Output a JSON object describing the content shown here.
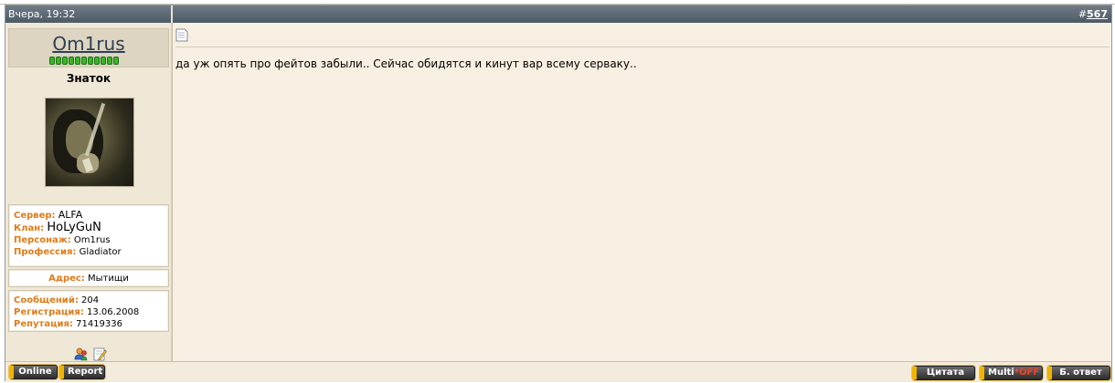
{
  "header": {
    "date": "Вчера, 19:32",
    "post_prefix": "#",
    "post_number": "567"
  },
  "user": {
    "name": "Om1rus",
    "title": "Знаток",
    "reputation_level": 11,
    "info": {
      "server_label": "Сервер:",
      "server_value": "ALFA",
      "clan_label": "Клан:",
      "clan_value": "HoLyGuN",
      "character_label": "Персонаж:",
      "character_value": "Om1rus",
      "profession_label": "Профессия:",
      "profession_value": "Gladiator",
      "address_label": "Адрес:",
      "address_value": "Мытищи",
      "posts_label": "Сообщений:",
      "posts_value": "204",
      "registered_label": "Регистрация:",
      "registered_value": "13.06.2008",
      "reputation_label": "Репутация:",
      "reputation_value": "71419336"
    },
    "icons": [
      "add-friend-icon",
      "edit-note-icon"
    ]
  },
  "post": {
    "icon": "document-icon",
    "text": "да уж опять про фейтов забыли.. Сейчас обидятся и кинут вар всему серваку.."
  },
  "footer": {
    "online_label": "Online",
    "report_label": "Report",
    "quote_label": "Цитата",
    "multi_label": "Multi",
    "multi_star": "*",
    "multi_state": "OFF",
    "reply_label": "Б. ответ"
  },
  "colors": {
    "header_bg": "#5b6874",
    "body_bg": "#f7f0e2",
    "label_orange": "#e07b18",
    "username_blue": "#2f4055",
    "rep_green": "#39b52a",
    "button_accent": "#f0b400"
  }
}
